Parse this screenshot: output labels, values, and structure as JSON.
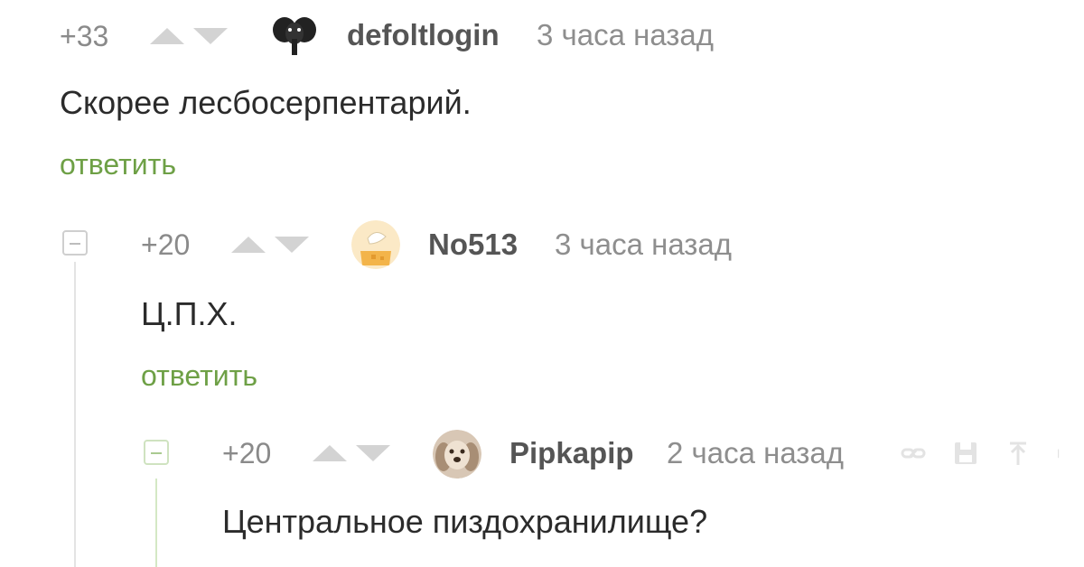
{
  "comments": [
    {
      "rating": "+33",
      "username": "defoltlogin",
      "time": "3 часа назад",
      "text": "Скорее лесбосерпентарий.",
      "reply": "ответить"
    },
    {
      "rating": "+20",
      "username": "No513",
      "time": "3 часа назад",
      "text": "Ц.П.Х.",
      "reply": "ответить"
    },
    {
      "rating": "+20",
      "username": "Pipkapip",
      "time": "2 часа назад",
      "text": "Центральное пиздохранилище?"
    }
  ],
  "colors": {
    "reply_link": "#6ea046",
    "thread_line_gray": "#cfcfcf",
    "thread_line_green": "#cfe3c0"
  },
  "icons": [
    "thumb-up-triangle-icon",
    "thumb-down-triangle-icon",
    "collapse-minus-icon",
    "link-icon",
    "save-icon",
    "share-icon"
  ]
}
